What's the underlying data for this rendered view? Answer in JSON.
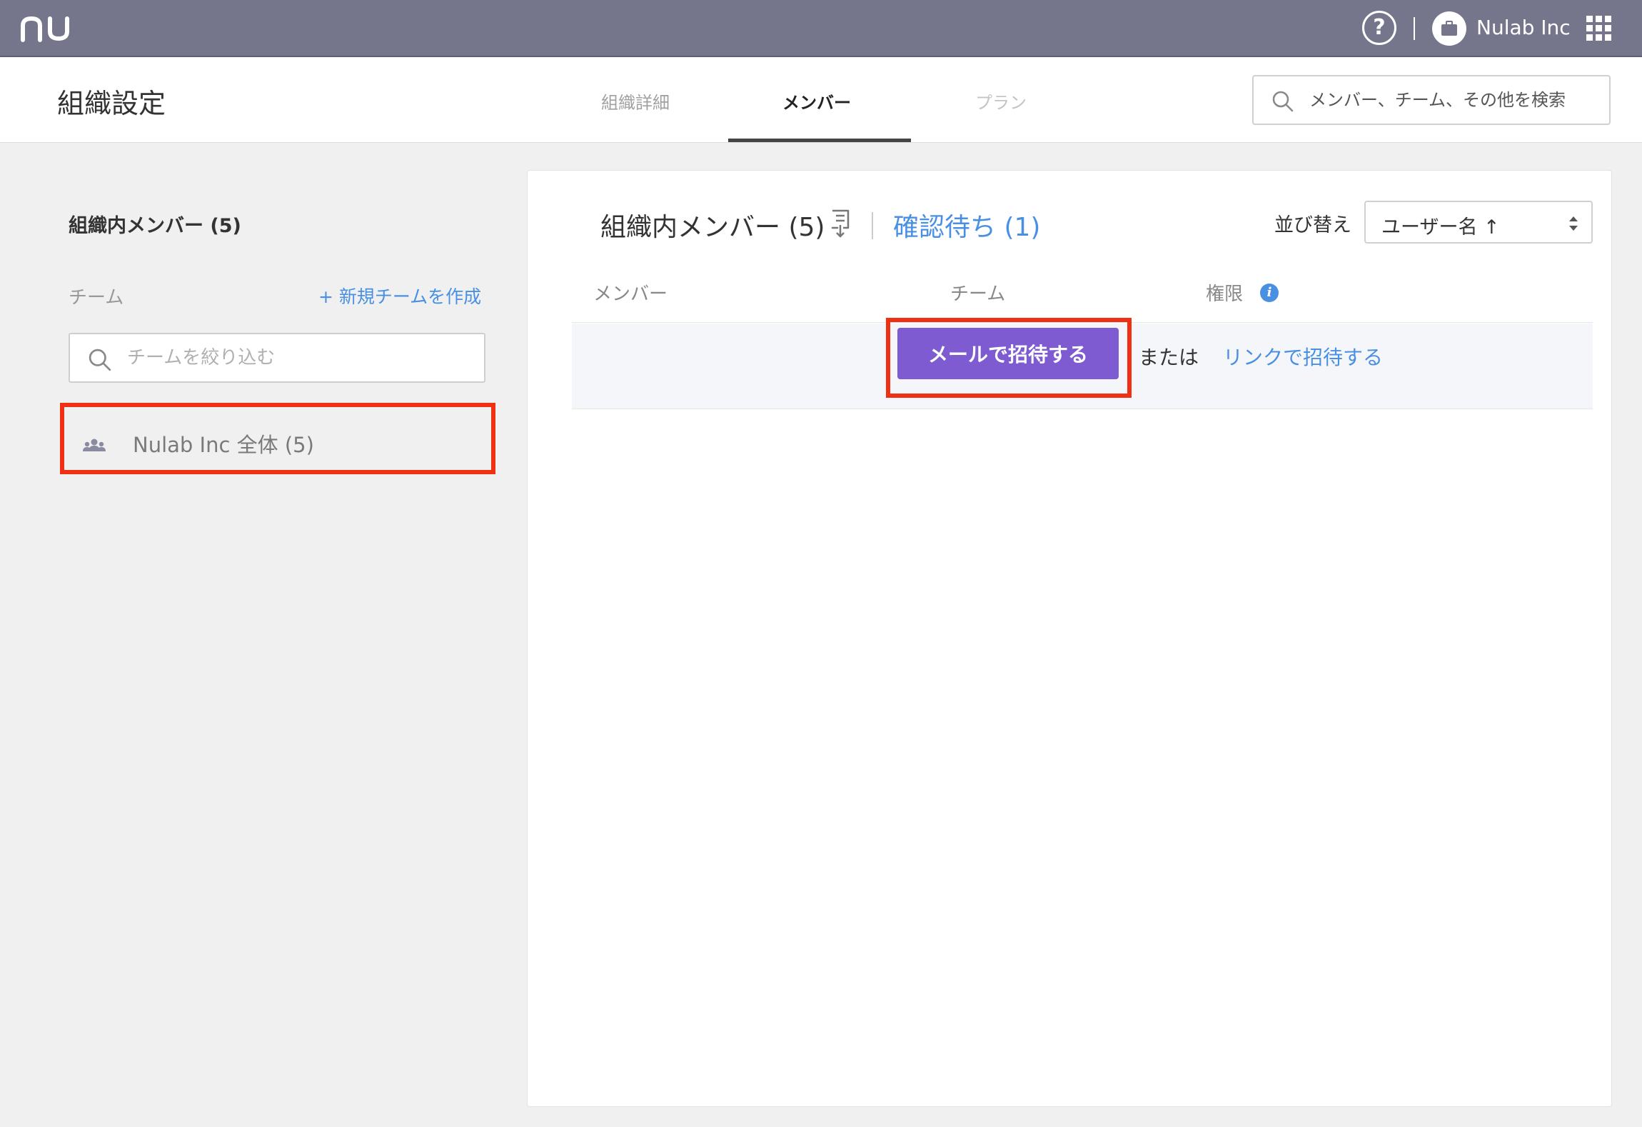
{
  "topbar": {
    "logo": "nu",
    "help_icon": "?",
    "org_name": "Nulab Inc"
  },
  "header": {
    "title": "組織設定",
    "tabs": [
      {
        "label": "組織詳細",
        "active": false
      },
      {
        "label": "メンバー",
        "active": true
      },
      {
        "label": "プラン",
        "active": false
      }
    ],
    "search_placeholder": "メンバー、チーム、その他を検索"
  },
  "sidebar": {
    "all_members_label": "組織内メンバー (5)",
    "team_label": "チーム",
    "new_team_link": "+ 新規チームを作成",
    "team_filter_placeholder": "チームを絞り込む",
    "teams": [
      {
        "label": "Nulab Inc 全体 (5)",
        "icon": "team-icon"
      }
    ]
  },
  "main": {
    "title": "組織内メンバー (5)",
    "pending_link": "確認待ち (1)",
    "sort_label": "並び替え",
    "sort_value": "ユーザー名 ↑",
    "columns": {
      "member": "メンバー",
      "team": "チーム",
      "role": "権限"
    },
    "info_icon": "i",
    "invite": {
      "button_label": "メールで招待する",
      "or_text": "または",
      "link_label": "リンクで招待する"
    }
  },
  "colors": {
    "topbar": "#75768b",
    "accent_purple": "#7e5bd0",
    "link_blue": "#4a90e2",
    "highlight_red": "#f03012"
  }
}
